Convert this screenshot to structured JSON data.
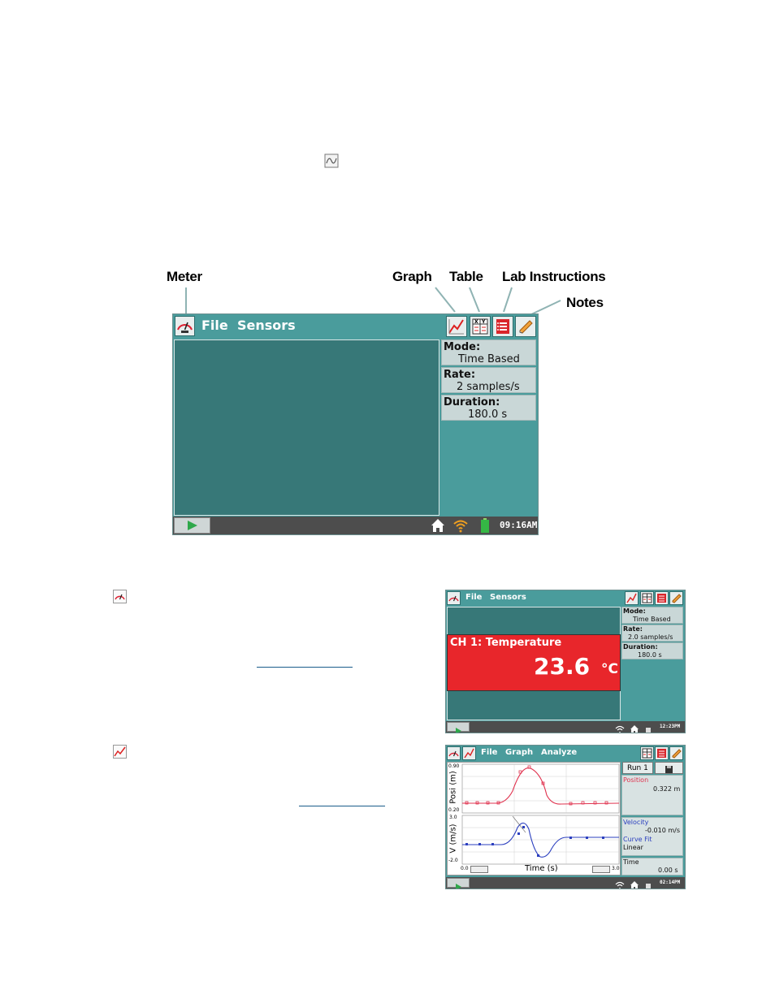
{
  "callouts": {
    "meter": "Meter",
    "graph": "Graph",
    "table": "Table",
    "lab_instructions": "Lab Instructions",
    "notes": "Notes"
  },
  "main_screen": {
    "menu": [
      "File",
      "Sensors"
    ],
    "mode_label": "Mode:",
    "mode_value": "Time Based",
    "rate_label": "Rate:",
    "rate_value": "2 samples/s",
    "duration_label": "Duration:",
    "duration_value": "180.0 s",
    "clock": "09:16AM"
  },
  "meter_screen": {
    "menu": [
      "File",
      "Sensors"
    ],
    "mode_label": "Mode:",
    "mode_value": "Time Based",
    "rate_label": "Rate:",
    "rate_value": "2.0 samples/s",
    "duration_label": "Duration:",
    "duration_value": "180.0 s",
    "channel": "CH 1: Temperature",
    "reading": "23.6",
    "unit": "°C",
    "clock": "12:23PM",
    "reading_color": "#e8262b"
  },
  "graph_screen": {
    "menu": [
      "File",
      "Graph",
      "Analyze"
    ],
    "run": "Run 1",
    "top_axis_label": "Posi (m)",
    "top_y_max": "0.90",
    "top_y_min": "0.20",
    "bottom_axis_label": "V (m/s)",
    "bottom_y_max": "3.0",
    "bottom_y_min": "-2.0",
    "x_min": "0.0",
    "x_max": "3.0",
    "x_label": "Time (s)",
    "position_label": "Position",
    "position_value": "0.322 m",
    "velocity_label": "Velocity",
    "velocity_value": "-0.010 m/s",
    "curve_fit_label": "Curve Fit",
    "curve_fit_value": "Linear",
    "time_label": "Time",
    "time_value": "0.00 s",
    "clock": "02:14PM",
    "position_color": "#e0334f",
    "velocity_color": "#2b3fbf"
  }
}
